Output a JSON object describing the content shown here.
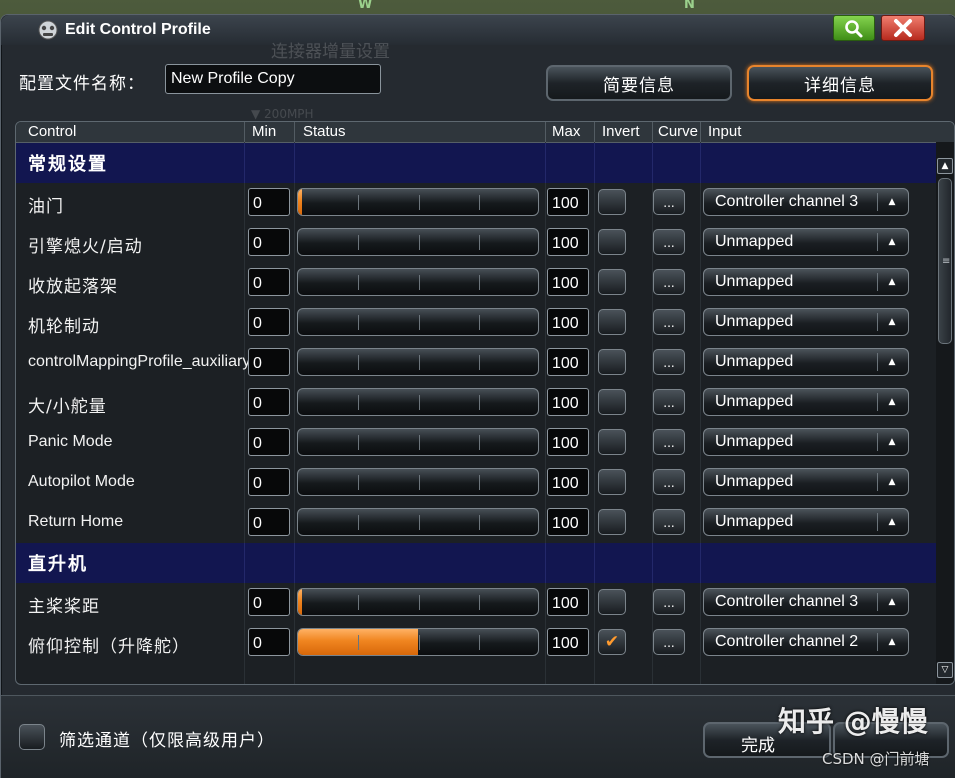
{
  "background": {
    "ghost_title": "连接器增量设置",
    "ghost_sub": "▼ 200MPH",
    "compass_w": "W",
    "compass_n": "N"
  },
  "window": {
    "title": "Edit Control Profile",
    "title_icon": "gamepad-icon",
    "search_icon": "search-icon",
    "close_icon": "close-icon"
  },
  "profile": {
    "name_label": "配置文件名称：",
    "name_value": "New Profile Copy"
  },
  "tabs": {
    "summary": "简要信息",
    "detail": "详细信息",
    "active": "detail"
  },
  "table": {
    "headers": {
      "control": "Control",
      "min": "Min",
      "status": "Status",
      "max": "Max",
      "invert": "Invert",
      "curve": "Curve",
      "input": "Input"
    },
    "rows": [
      {
        "kind": "section",
        "label": "常规设置"
      },
      {
        "kind": "control",
        "label": "油门",
        "latin": false,
        "min": "0",
        "max": "100",
        "status": 0.01,
        "inverted": false,
        "curve": "...",
        "input": "Controller channel 3"
      },
      {
        "kind": "control",
        "label": "引擎熄火/启动",
        "latin": false,
        "min": "0",
        "max": "100",
        "status": 0,
        "inverted": false,
        "curve": "...",
        "input": "Unmapped"
      },
      {
        "kind": "control",
        "label": "收放起落架",
        "latin": false,
        "min": "0",
        "max": "100",
        "status": 0,
        "inverted": false,
        "curve": "...",
        "input": "Unmapped"
      },
      {
        "kind": "control",
        "label": "机轮制动",
        "latin": false,
        "min": "0",
        "max": "100",
        "status": 0,
        "inverted": false,
        "curve": "...",
        "input": "Unmapped"
      },
      {
        "kind": "control",
        "label": "controlMappingProfile_auxiliaryMode",
        "latin": true,
        "min": "0",
        "max": "100",
        "status": 0,
        "inverted": false,
        "curve": "...",
        "input": "Unmapped"
      },
      {
        "kind": "control",
        "label": "大/小舵量",
        "latin": false,
        "min": "0",
        "max": "100",
        "status": 0,
        "inverted": false,
        "curve": "...",
        "input": "Unmapped"
      },
      {
        "kind": "control",
        "label": "Panic Mode",
        "latin": true,
        "min": "0",
        "max": "100",
        "status": 0,
        "inverted": false,
        "curve": "...",
        "input": "Unmapped"
      },
      {
        "kind": "control",
        "label": "Autopilot Mode",
        "latin": true,
        "min": "0",
        "max": "100",
        "status": 0,
        "inverted": false,
        "curve": "...",
        "input": "Unmapped"
      },
      {
        "kind": "control",
        "label": "Return Home",
        "latin": true,
        "min": "0",
        "max": "100",
        "status": 0,
        "inverted": false,
        "curve": "...",
        "input": "Unmapped"
      },
      {
        "kind": "section",
        "label": "直升机"
      },
      {
        "kind": "control",
        "label": "主桨桨距",
        "latin": false,
        "min": "0",
        "max": "100",
        "status": 0.01,
        "inverted": false,
        "curve": "...",
        "input": "Controller channel 3"
      },
      {
        "kind": "control",
        "label": "俯仰控制（升降舵）",
        "latin": false,
        "min": "0",
        "max": "100",
        "status": 0.5,
        "inverted": true,
        "curve": "...",
        "input": "Controller channel 2"
      }
    ],
    "invert_mark": "✔",
    "dropdown_arrow": "▲",
    "scroll_up": "▲",
    "scroll_down": "▽",
    "scroll_grip": "≡"
  },
  "colors": {
    "accent_orange": "#f08520",
    "section_bg": "#121650",
    "search_green": "#5fb52f",
    "close_red": "#d23b2c"
  },
  "footer": {
    "filter_label": "筛选通道（仅限高级用户）",
    "done_label": "完成"
  },
  "watermark": {
    "main": "知乎 @慢慢",
    "sub": "CSDN @门前塘"
  }
}
